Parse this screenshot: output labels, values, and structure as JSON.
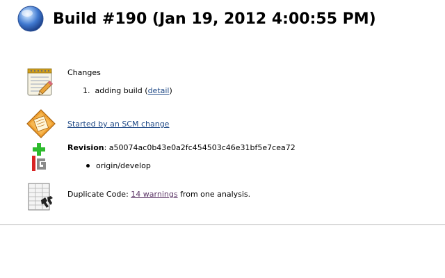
{
  "page": {
    "title": "Build #190 (Jan 19, 2012 4:00:55 PM)",
    "status_color": "#3465a4"
  },
  "changes": {
    "heading": "Changes",
    "items": [
      {
        "number": "1.",
        "message": "adding build",
        "open_paren": "(",
        "detail_link": "detail",
        "close_paren": ")"
      }
    ],
    "icon": "notepad-icon"
  },
  "cause": {
    "text": "Started by an SCM change",
    "icon": "scm-change-icon"
  },
  "revision": {
    "label": "Revision",
    "separator": ":",
    "hash": "a50074ac0b43e0a2fc454503c46e31bf5e7cea72",
    "branches": [
      "origin/develop"
    ],
    "icon": "git-icon"
  },
  "duplicate_code": {
    "prefix": "Duplicate Code:",
    "warnings_link": "14 warnings",
    "suffix": "from one analysis.",
    "icon": "duplicate-code-icon"
  },
  "colors": {
    "link": "#204a87",
    "visited_link": "#5c3566",
    "git_plus": "#2dbb2d",
    "git_red": "#d82323"
  }
}
